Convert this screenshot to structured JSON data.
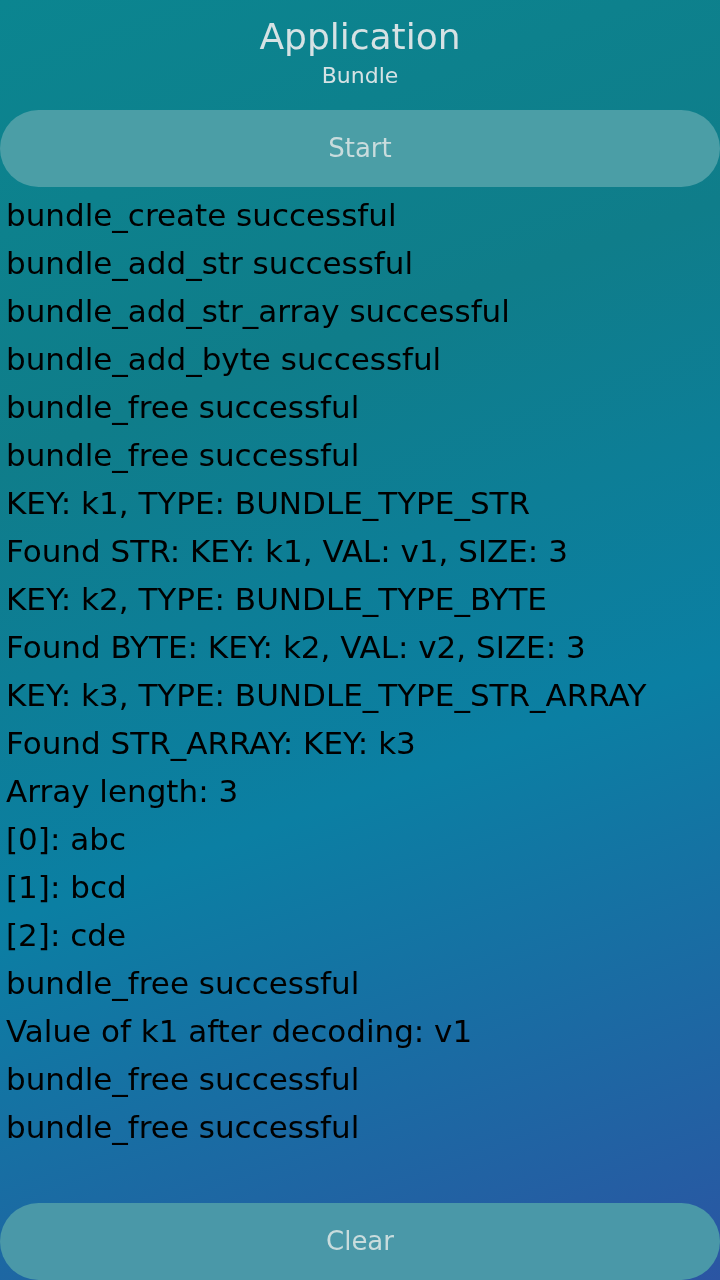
{
  "header": {
    "title": "Application",
    "subtitle": "Bundle"
  },
  "start_button": {
    "label": "Start"
  },
  "log": [
    "bundle_create successful",
    "bundle_add_str successful",
    "bundle_add_str_array successful",
    "bundle_add_byte successful",
    "bundle_free successful",
    "bundle_free successful",
    "KEY: k1, TYPE: BUNDLE_TYPE_STR",
    "Found STR: KEY: k1, VAL: v1, SIZE: 3",
    "KEY: k2, TYPE: BUNDLE_TYPE_BYTE",
    "Found BYTE: KEY: k2, VAL: v2, SIZE: 3",
    "KEY: k3, TYPE: BUNDLE_TYPE_STR_ARRAY",
    "Found STR_ARRAY: KEY: k3",
    "Array length: 3",
    "[0]: abc",
    "[1]: bcd",
    "[2]: cde",
    "bundle_free successful",
    "Value of k1 after decoding: v1",
    "bundle_free successful",
    "bundle_free successful"
  ],
  "clear_button": {
    "label": "Clear"
  }
}
